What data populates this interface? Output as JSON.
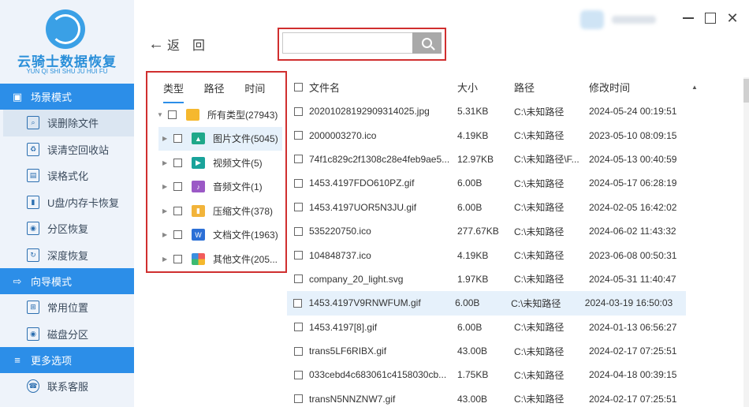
{
  "app": {
    "name": "云骑士数据恢复",
    "subtitle": "YUN QI SHI SHU JU HUI FU"
  },
  "sidebar": {
    "sections": [
      {
        "label": "场景模式",
        "items": [
          "误删除文件",
          "误清空回收站",
          "误格式化",
          "U盘/内存卡恢复",
          "分区恢复",
          "深度恢复"
        ]
      },
      {
        "label": "向导模式",
        "items": [
          "常用位置",
          "磁盘分区"
        ]
      },
      {
        "label": "更多选项",
        "items": [
          "联系客服"
        ]
      }
    ]
  },
  "toolbar": {
    "back_label": "返",
    "back2_label": "回",
    "search_placeholder": ""
  },
  "categories": {
    "tabs": [
      "类型",
      "路径",
      "时间"
    ],
    "root": "所有类型(27943)",
    "items": [
      "图片文件(5045)",
      "视频文件(5)",
      "音频文件(1)",
      "压缩文件(378)",
      "文档文件(1963)",
      "其他文件(205..."
    ]
  },
  "table": {
    "headers": [
      "文件名",
      "大小",
      "路径",
      "修改时间"
    ],
    "rows": [
      [
        "20201028192909314025.jpg",
        "5.31KB",
        "C:\\未知路径",
        "2024-05-24 00:19:51"
      ],
      [
        "2000003270.ico",
        "4.19KB",
        "C:\\未知路径",
        "2023-05-10 08:09:15"
      ],
      [
        "74f1c829c2f1308c28e4feb9ae5...",
        "12.97KB",
        "C:\\未知路径\\F...",
        "2024-05-13 00:40:59"
      ],
      [
        "1453.4197FDO610PZ.gif",
        "6.00B",
        "C:\\未知路径",
        "2024-05-17 06:28:19"
      ],
      [
        "1453.4197UOR5N3JU.gif",
        "6.00B",
        "C:\\未知路径",
        "2024-02-05 16:42:02"
      ],
      [
        "535220750.ico",
        "277.67KB",
        "C:\\未知路径",
        "2024-06-02 11:43:32"
      ],
      [
        "104848737.ico",
        "4.19KB",
        "C:\\未知路径",
        "2023-06-08 00:50:31"
      ],
      [
        "company_20_light.svg",
        "1.97KB",
        "C:\\未知路径",
        "2024-05-31 11:40:47"
      ],
      [
        "1453.4197V9RNWFUM.gif",
        "6.00B",
        "C:\\未知路径",
        "2024-03-19 16:50:03"
      ],
      [
        "1453.4197[8].gif",
        "6.00B",
        "C:\\未知路径",
        "2024-01-13 06:56:27"
      ],
      [
        "trans5LF6RIBX.gif",
        "43.00B",
        "C:\\未知路径",
        "2024-02-17 07:25:51"
      ],
      [
        "033cebd4c683061c4158030cb...",
        "1.75KB",
        "C:\\未知路径",
        "2024-04-18 00:39:15"
      ],
      [
        "transN5NNZNW7.gif",
        "43.00B",
        "C:\\未知路径",
        "2024-02-17 07:25:51"
      ]
    ]
  }
}
